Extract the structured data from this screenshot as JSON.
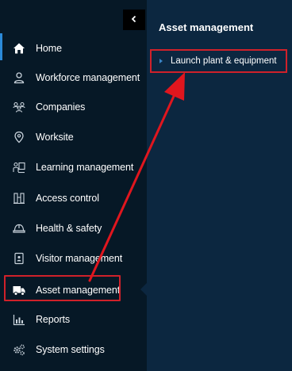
{
  "sidebar": {
    "collapse_icon": "chevron-left-icon",
    "items": [
      {
        "label": "Home",
        "icon": "home-icon"
      },
      {
        "label": "Workforce management",
        "icon": "user-icon"
      },
      {
        "label": "Companies",
        "icon": "users-group-icon"
      },
      {
        "label": "Worksite",
        "icon": "location-pin-icon"
      },
      {
        "label": "Learning management",
        "icon": "learning-icon"
      },
      {
        "label": "Access control",
        "icon": "turnstile-icon"
      },
      {
        "label": "Health & safety",
        "icon": "hard-hat-icon"
      },
      {
        "label": "Visitor management",
        "icon": "visitor-badge-icon"
      },
      {
        "label": "Asset management",
        "icon": "truck-icon"
      },
      {
        "label": "Reports",
        "icon": "bar-chart-icon"
      },
      {
        "label": "System settings",
        "icon": "gears-icon"
      }
    ]
  },
  "panel": {
    "title": "Asset management",
    "items": [
      {
        "label": "Launch plant & equipment"
      }
    ]
  },
  "colors": {
    "sidebar_bg": "#061826",
    "panel_bg": "#0c2740",
    "accent": "#2b8ad8",
    "annotation_red": "#d0212a"
  }
}
